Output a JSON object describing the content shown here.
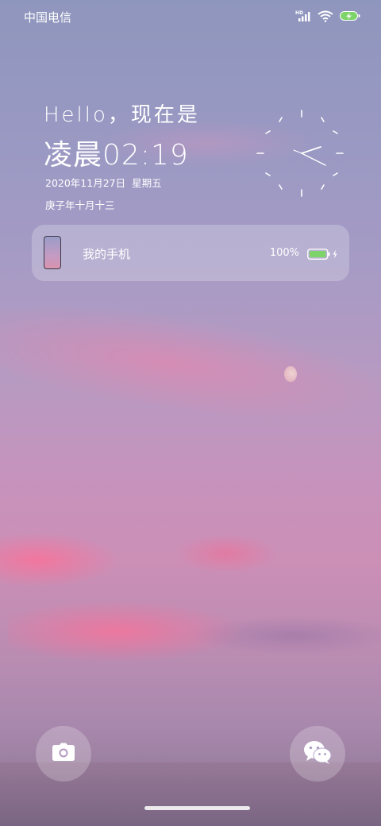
{
  "status_bar": {
    "carrier": "中国电信",
    "icons": [
      "hd-signal-icon",
      "wifi-icon",
      "battery-charging-icon"
    ]
  },
  "greeting": "Hello，现在是",
  "time": {
    "period": "凌晨",
    "clock": "02:19"
  },
  "date": {
    "date": "2020年11月27日",
    "weekday": "星期五",
    "lunar": "庚子年十月十三"
  },
  "device_card": {
    "name": "我的手机",
    "battery": "100%",
    "charging": true
  },
  "shortcuts": {
    "left": "camera-icon",
    "right": "wechat-icon"
  },
  "colors": {
    "accent_battery": "#7fd36b",
    "charge_bolt": "#ffffff"
  }
}
